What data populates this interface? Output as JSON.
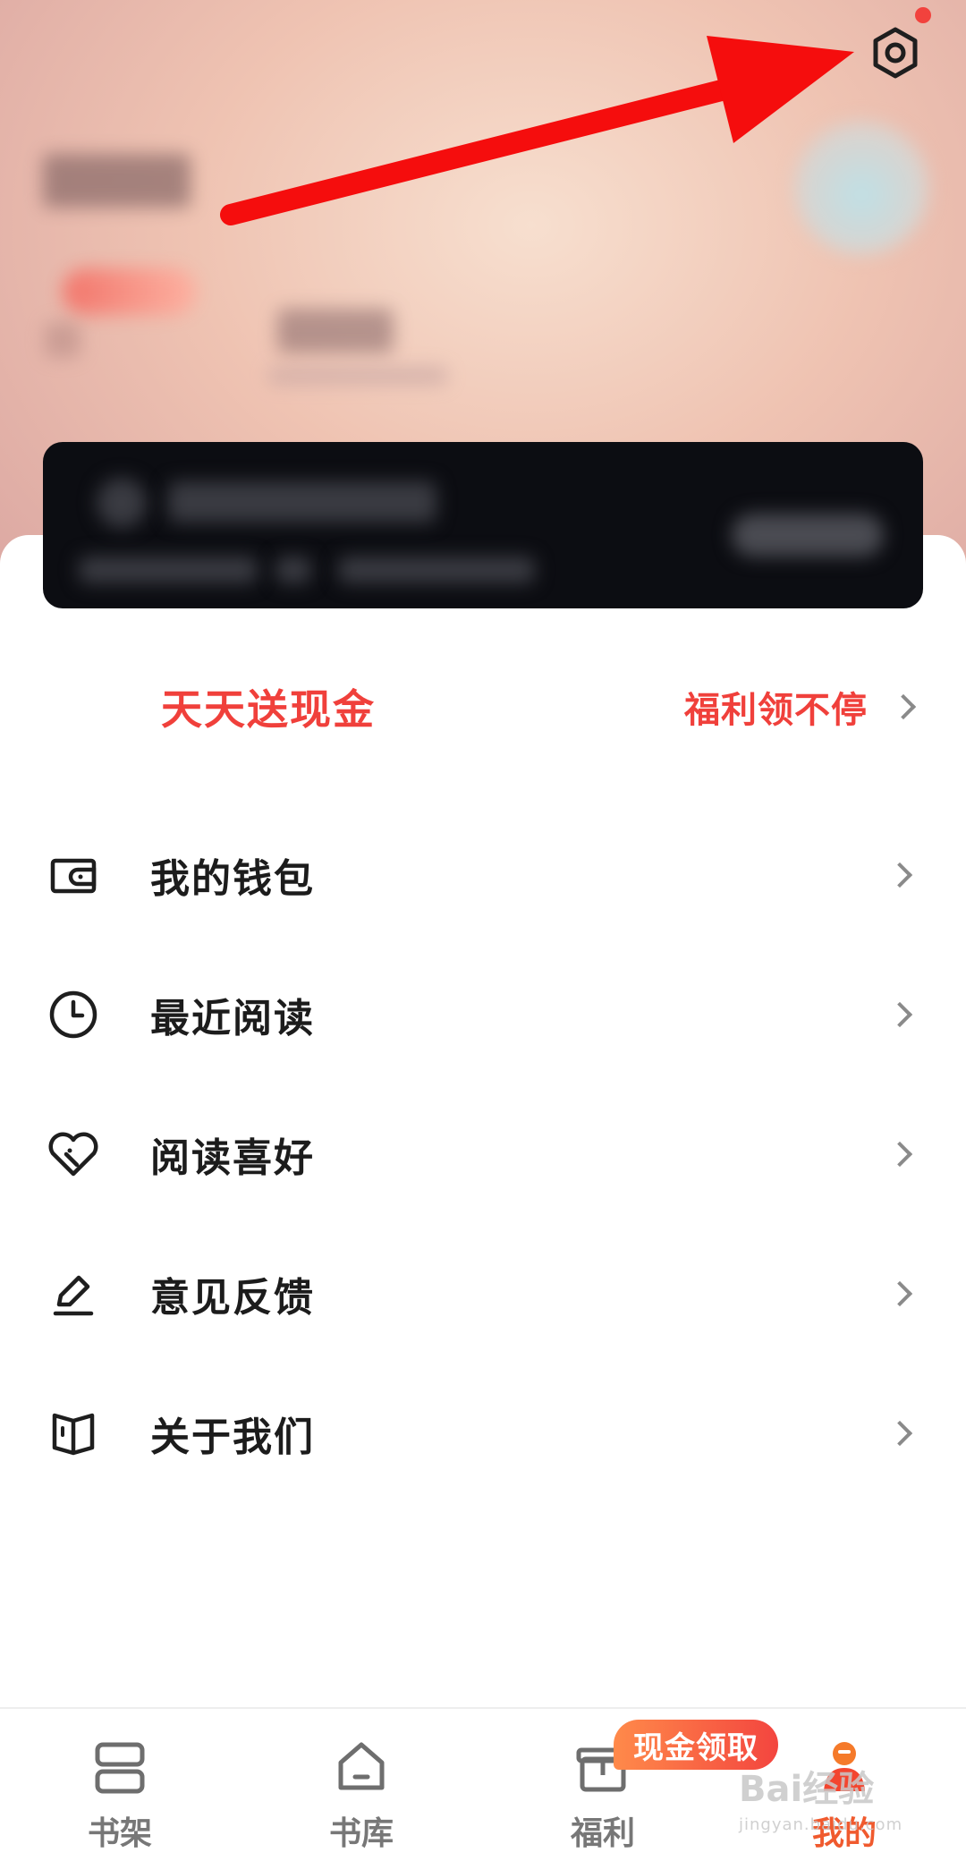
{
  "promo": {
    "title": "天天送现金",
    "right_text": "福利领不停"
  },
  "menu": {
    "items": [
      {
        "label": "我的钱包",
        "icon": "wallet-icon"
      },
      {
        "label": "最近阅读",
        "icon": "clock-icon"
      },
      {
        "label": "阅读喜好",
        "icon": "heart-tag-icon"
      },
      {
        "label": "意见反馈",
        "icon": "edit-pen-icon"
      },
      {
        "label": "关于我们",
        "icon": "book-icon"
      }
    ]
  },
  "bottom_nav": {
    "items": [
      {
        "label": "书架",
        "icon": "bookshelf-icon"
      },
      {
        "label": "书库",
        "icon": "home-icon"
      },
      {
        "label": "福利",
        "icon": "gift-icon"
      },
      {
        "label": "我的",
        "icon": "profile-icon"
      }
    ],
    "active": "我的",
    "badge": "现金领取"
  },
  "watermark": {
    "main": "Bai经验",
    "sub": "jingyan.baidu.com"
  },
  "colors": {
    "accent": "#f0403b",
    "nav_active": "#f05a2e",
    "card": "#0c0d12"
  }
}
